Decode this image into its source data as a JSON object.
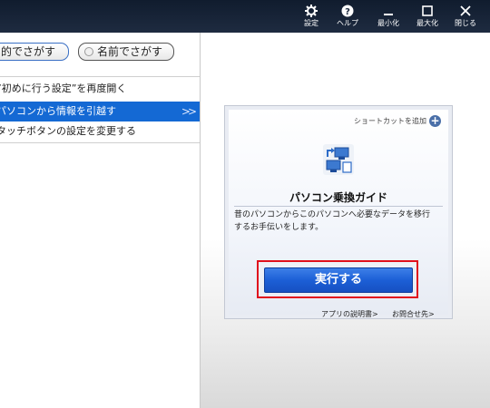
{
  "toolbar": {
    "buttons": [
      {
        "label": "設定",
        "icon": "gear-icon"
      },
      {
        "label": "ヘルプ",
        "icon": "help-icon"
      },
      {
        "label": "最小化",
        "icon": "minimize-icon"
      },
      {
        "label": "最大化",
        "icon": "maximize-icon"
      },
      {
        "label": "閉じる",
        "icon": "close-icon"
      }
    ]
  },
  "search": {
    "purpose_label": "目的でさがす",
    "name_label": "名前でさがす"
  },
  "menu": {
    "items": [
      {
        "label": "”初めに行う設定”を再度開く",
        "active": false
      },
      {
        "label": "パソコンから情報を引越す",
        "active": true
      },
      {
        "label": "タッチボタンの設定を変更する",
        "active": false
      }
    ],
    "active_chevron": ">>"
  },
  "app_card": {
    "shortcut_label": "ショートカットを追加",
    "shortcut_icon": "plus-circle-icon",
    "app_icon": "pc-transfer-icon",
    "title": "パソコン乗換ガイド",
    "description_line1": "昔のパソコンからこのパソコンへ必要なデータを移行",
    "description_line2": "するお手伝いをします。",
    "run_button": "実行する",
    "app_description_link": "アプリの説明書>",
    "contact_link": "お問合せ先>"
  },
  "colors": {
    "topbar": "#101c2e",
    "active_item": "#1469d4",
    "run_button": "#1c5fd6",
    "highlight_box": "#e0101d"
  }
}
